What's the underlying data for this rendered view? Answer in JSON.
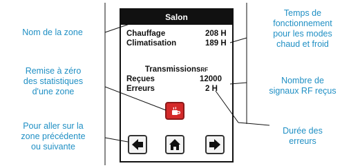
{
  "device": {
    "title": "Salon",
    "rows_usage": [
      {
        "label": "Chauffage",
        "value": "208 H"
      },
      {
        "label": "Climatisation",
        "value": "189 H"
      }
    ],
    "rf_heading": "Transmissions",
    "rf_heading_suffix": "RF",
    "rows_rf": [
      {
        "label": "Reçues",
        "value": "12000"
      },
      {
        "label": "Erreurs",
        "value": "2 H"
      }
    ],
    "buttons": {
      "reset_icon": "reset-icon",
      "prev_icon": "arrow-left-icon",
      "home_icon": "home-icon",
      "next_icon": "arrow-right-icon"
    }
  },
  "callouts": {
    "zone_name": [
      "Nom de la zone"
    ],
    "reset": [
      "Remise à zéro",
      "des statistiques",
      "d'une zone"
    ],
    "navigate": [
      "Pour aller sur la",
      "zone précédente",
      "ou suivante"
    ],
    "run_time": [
      "Temps de",
      "fonctionnement",
      "pour les modes",
      "chaud et froid"
    ],
    "rf_count": [
      "Nombre de",
      "signaux RF reçus"
    ],
    "error_duration": [
      "Durée des",
      "erreurs"
    ]
  },
  "colors": {
    "callout": "#1f8fc4",
    "reset_button": "#d42a2a",
    "line": "#111111"
  }
}
